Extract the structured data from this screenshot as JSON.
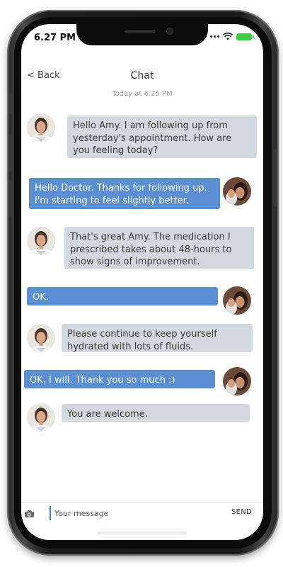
{
  "status_bar": {
    "time": "6.27 PM",
    "wifi_icon": "wifi-icon",
    "battery_icon": "battery-icon",
    "battery_color": "#3ccc48"
  },
  "header": {
    "back_label": "< Back",
    "title": "Chat"
  },
  "timestamp": "Today at 6.25 PM",
  "colors": {
    "doctor_bubble": "#d3d8de",
    "patient_bubble": "#5b8ed2"
  },
  "messages": [
    {
      "sender": "doctor",
      "avatar": "doctor-avatar",
      "text": "Hello Amy. I am following up from yesterday's appointment. How are you feeling today?"
    },
    {
      "sender": "patient",
      "avatar": "patient-avatar",
      "text": "Hello Doctor. Thanks for following up. I'm starting to feel slightly better."
    },
    {
      "sender": "doctor",
      "avatar": "doctor-avatar",
      "text": "That's great Amy. The medication I prescribed takes about 48-hours to show signs of improvement."
    },
    {
      "sender": "patient",
      "avatar": "patient-avatar",
      "text": "OK."
    },
    {
      "sender": "doctor",
      "avatar": "doctor-avatar",
      "text": "Please continue to keep yourself hydrated with lots of fluids."
    },
    {
      "sender": "patient",
      "avatar": "patient-avatar",
      "text": "OK, I will. Thank you so much :)"
    },
    {
      "sender": "doctor",
      "avatar": "doctor-avatar",
      "text": "You are welcome."
    }
  ],
  "input": {
    "camera_icon": "camera-icon",
    "placeholder": "Your message",
    "value": "",
    "send_label": "SEND"
  }
}
